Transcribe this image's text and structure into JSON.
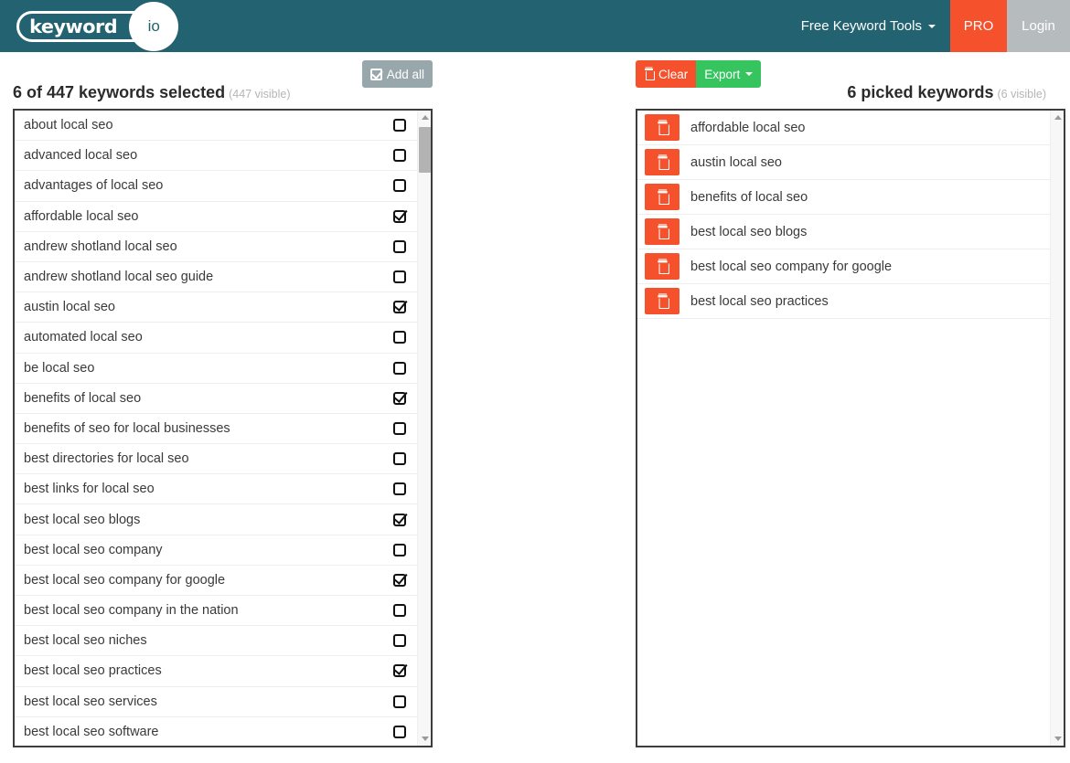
{
  "header": {
    "logo_word": "keyword",
    "logo_suffix": "io",
    "nav": {
      "tools_label": "Free Keyword Tools",
      "pro_label": "PRO",
      "login_label": "Login"
    },
    "brand_color": "#236371",
    "pro_color": "#f4512c",
    "login_color": "#b6bcbd"
  },
  "left_panel": {
    "title": "6 of 447 keywords selected",
    "subtitle": "(447 visible)",
    "add_all_label": "Add all",
    "add_all_icon": "check-square-icon",
    "selected_count": 6,
    "total_count": 447,
    "visible_count": 447,
    "keywords": [
      {
        "text": "about local seo",
        "checked": false
      },
      {
        "text": "advanced local seo",
        "checked": false
      },
      {
        "text": "advantages of local seo",
        "checked": false
      },
      {
        "text": "affordable local seo",
        "checked": true
      },
      {
        "text": "andrew shotland local seo",
        "checked": false
      },
      {
        "text": "andrew shotland local seo guide",
        "checked": false
      },
      {
        "text": "austin local seo",
        "checked": true
      },
      {
        "text": "automated local seo",
        "checked": false
      },
      {
        "text": "be local seo",
        "checked": false
      },
      {
        "text": "benefits of local seo",
        "checked": true
      },
      {
        "text": "benefits of seo for local businesses",
        "checked": false
      },
      {
        "text": "best directories for local seo",
        "checked": false
      },
      {
        "text": "best links for local seo",
        "checked": false
      },
      {
        "text": "best local seo blogs",
        "checked": true
      },
      {
        "text": "best local seo company",
        "checked": false
      },
      {
        "text": "best local seo company for google",
        "checked": true
      },
      {
        "text": "best local seo company in the nation",
        "checked": false
      },
      {
        "text": "best local seo niches",
        "checked": false
      },
      {
        "text": "best local seo practices",
        "checked": true
      },
      {
        "text": "best local seo services",
        "checked": false
      },
      {
        "text": "best local seo software",
        "checked": false
      }
    ]
  },
  "right_panel": {
    "title": "6 picked keywords",
    "subtitle": "(6 visible)",
    "clear_label": "Clear",
    "clear_icon": "trash-icon",
    "export_label": "Export",
    "export_icon": "caret-down-icon",
    "picked_count": 6,
    "visible_count": 6,
    "clear_color": "#f4512c",
    "export_color": "#36c45f",
    "keywords": [
      {
        "text": "affordable local seo"
      },
      {
        "text": "austin local seo"
      },
      {
        "text": "benefits of local seo"
      },
      {
        "text": "best local seo blogs"
      },
      {
        "text": "best local seo company for google"
      },
      {
        "text": "best local seo practices"
      }
    ]
  }
}
